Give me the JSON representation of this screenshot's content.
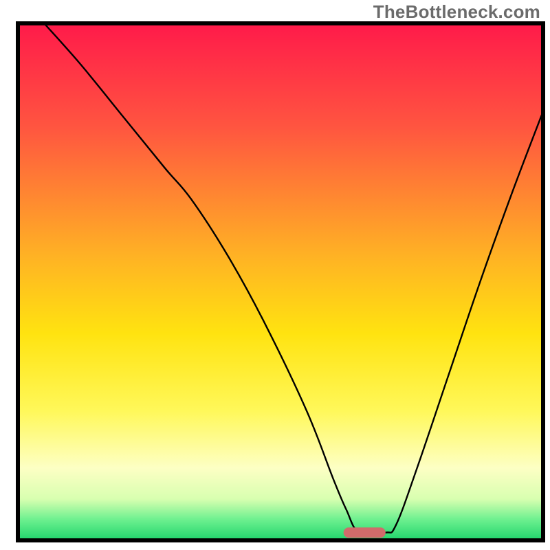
{
  "watermark": "TheBottleneck.com",
  "chart_data": {
    "type": "line",
    "title": "",
    "xlabel": "",
    "ylabel": "",
    "xlim": [
      0,
      100
    ],
    "ylim": [
      0,
      100
    ],
    "marker": {
      "x": 66,
      "y": 1.5,
      "width": 8,
      "height": 2,
      "color": "#d06b6b"
    },
    "background_gradient": {
      "stops": [
        {
          "offset": 0,
          "color": "#ff1a4a"
        },
        {
          "offset": 20,
          "color": "#ff5540"
        },
        {
          "offset": 45,
          "color": "#ffb224"
        },
        {
          "offset": 60,
          "color": "#ffe310"
        },
        {
          "offset": 75,
          "color": "#fff85a"
        },
        {
          "offset": 86,
          "color": "#fdffc4"
        },
        {
          "offset": 92,
          "color": "#d8ffb0"
        },
        {
          "offset": 96,
          "color": "#6cf08f"
        },
        {
          "offset": 100,
          "color": "#1fd36b"
        }
      ]
    },
    "curve": {
      "x": [
        5,
        12,
        20,
        28,
        33,
        40,
        47,
        55,
        60,
        62.5,
        65,
        70,
        72,
        76,
        82,
        88,
        94,
        100
      ],
      "y": [
        100,
        92,
        82,
        72,
        66,
        55,
        42,
        25,
        12,
        6,
        1.5,
        1.5,
        3,
        14,
        32,
        50,
        67,
        83
      ]
    }
  }
}
